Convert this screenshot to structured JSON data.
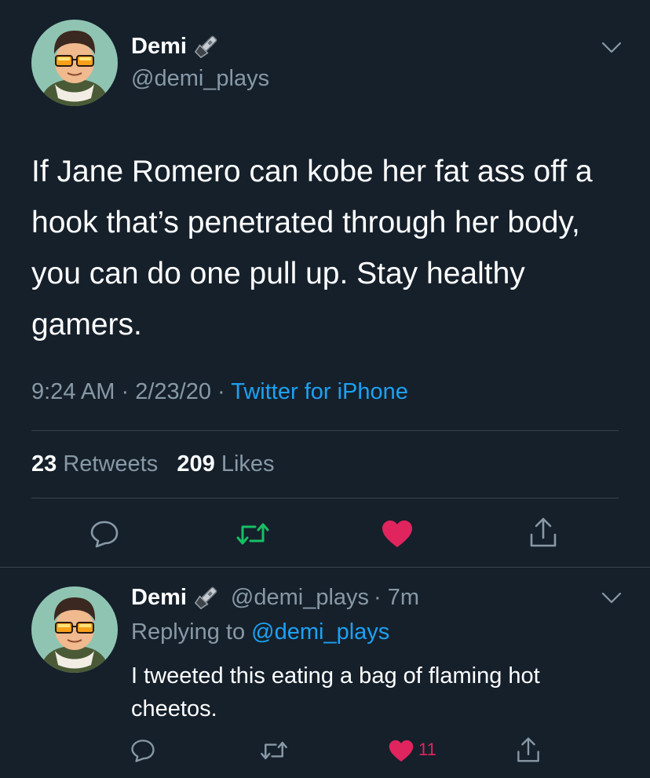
{
  "main_tweet": {
    "author_name": "Demi",
    "author_handle": "@demi_plays",
    "text": "If Jane Romero can kobe her fat ass off a hook that’s penetrated through her body, you can do one pull up. Stay healthy gamers.",
    "time": "9:24 AM",
    "date": "2/23/20",
    "separator": "·",
    "source": "Twitter for iPhone",
    "retweets_count": "23",
    "retweets_label": "Retweets",
    "likes_count": "209",
    "likes_label": "Likes",
    "badge_icon": "flashlight-icon",
    "actions": [
      "reply-icon",
      "retweet-icon",
      "like-icon",
      "share-icon"
    ],
    "liked": true
  },
  "reply": {
    "author_name": "Demi",
    "author_handle": "@demi_plays",
    "age": "· 7m",
    "replying_prefix": "Replying to",
    "replying_to": "@demi_plays",
    "text": "I tweeted this eating a bag of flaming hot cheetos.",
    "like_count": "11",
    "actions": [
      "reply-icon",
      "retweet-icon",
      "like-icon",
      "share-icon"
    ],
    "liked": true
  },
  "colors": {
    "background": "#15202b",
    "secondary_text": "#8899a6",
    "link": "#1da1f2",
    "like": "#e0245e",
    "retweet_active": "#17bf63",
    "divider": "#38444d"
  }
}
